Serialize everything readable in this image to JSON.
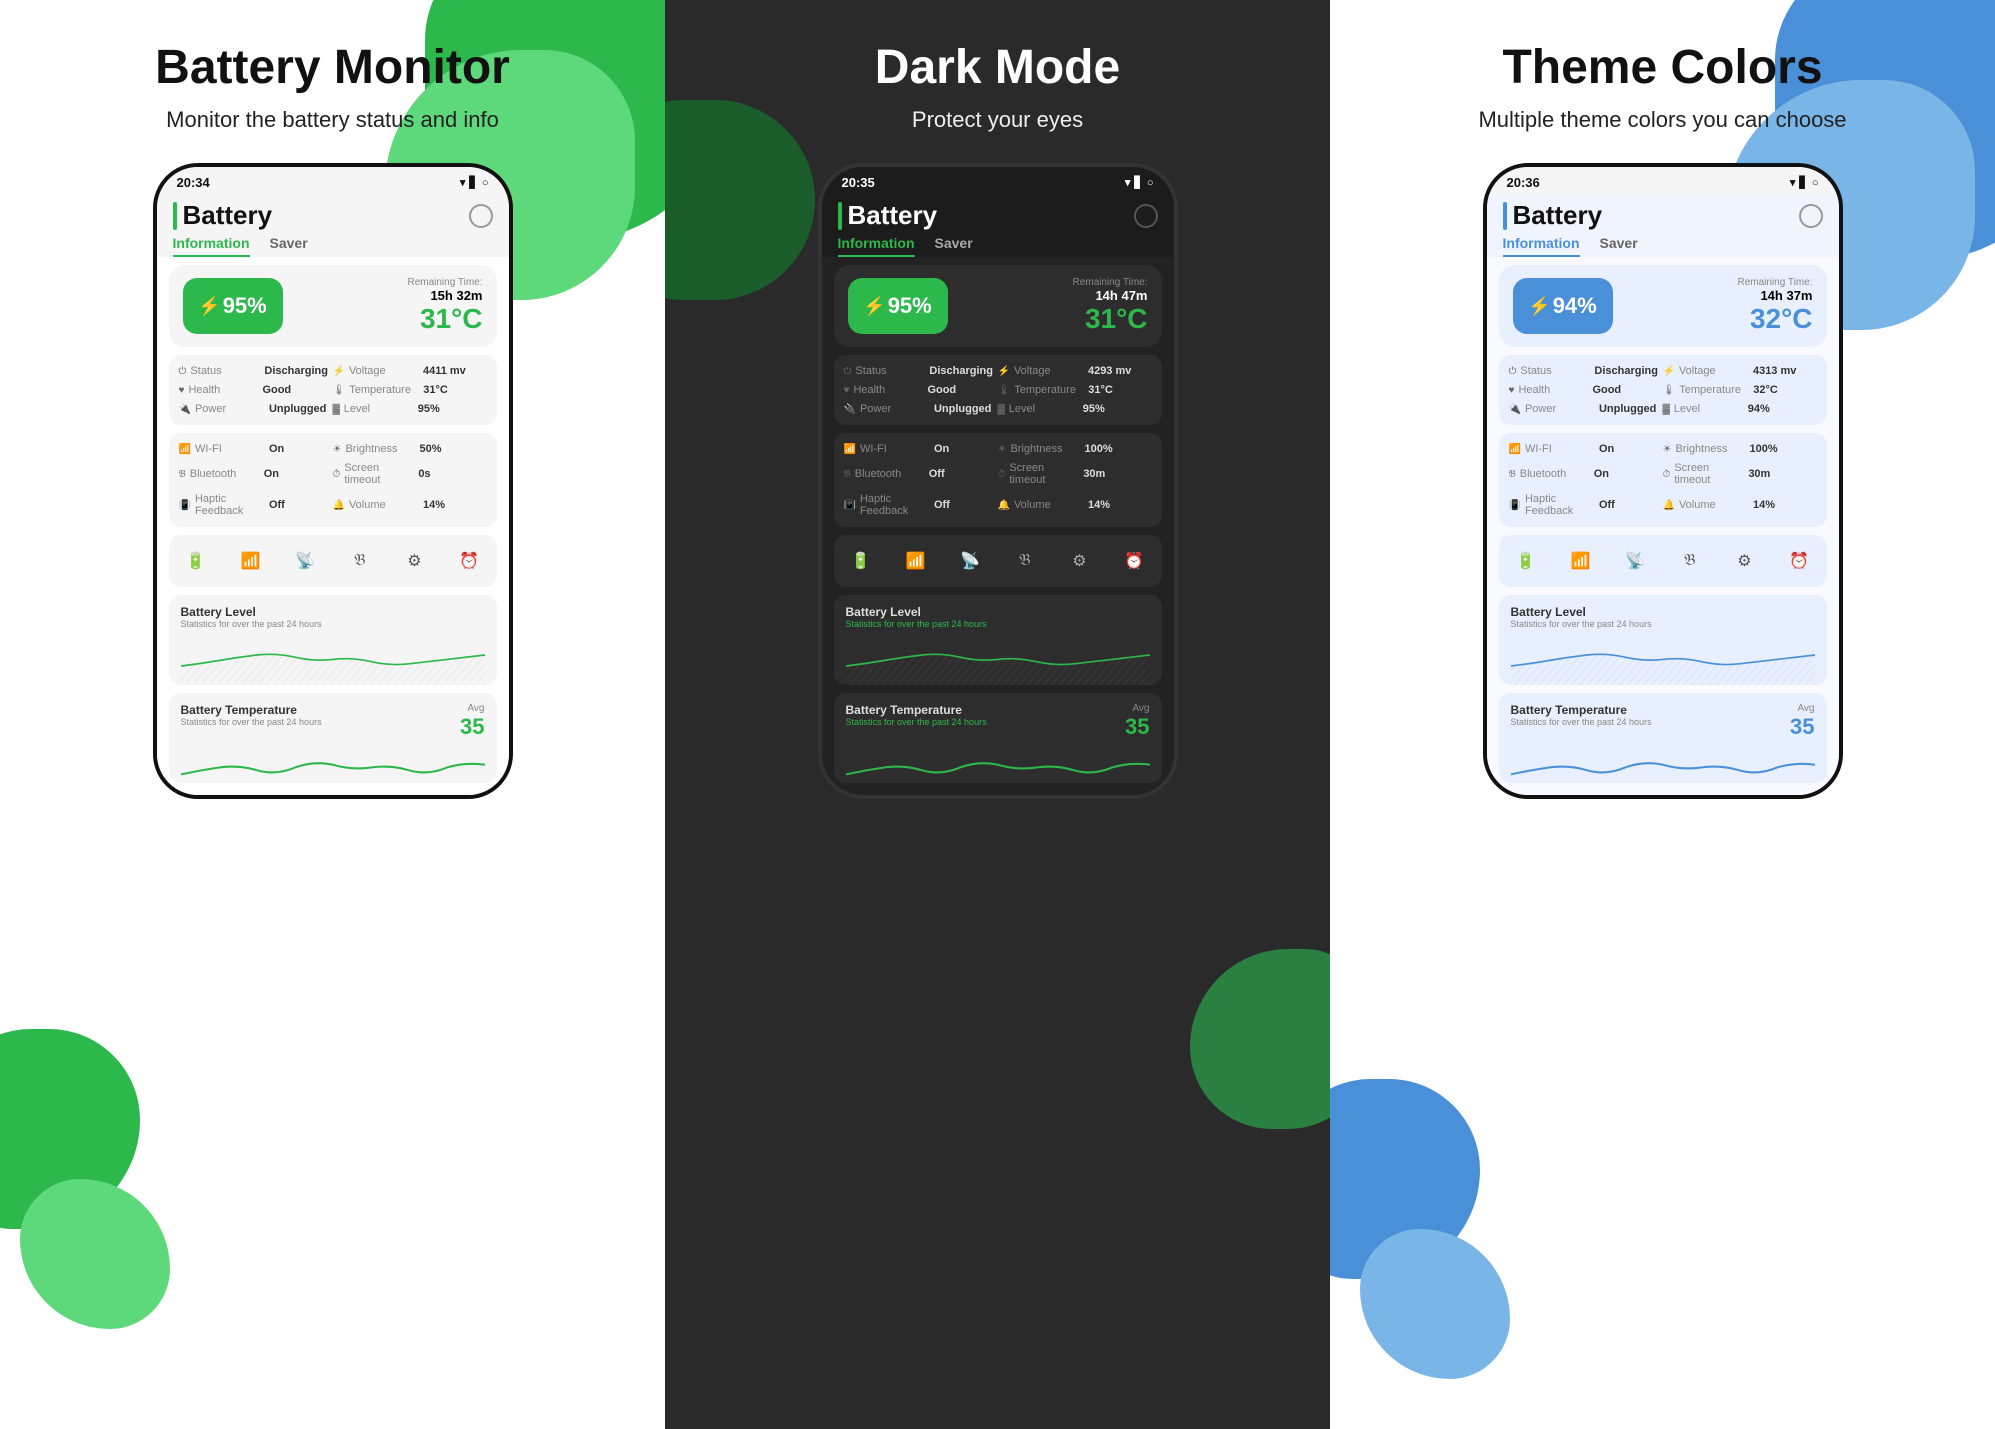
{
  "panel1": {
    "title": "Battery Monitor",
    "subtitle": "Monitor the battery status and info",
    "theme": "light",
    "phone": {
      "time": "20:34",
      "tab_info": "Information",
      "tab_saver": "Saver",
      "battery_pct": "95%",
      "remaining_label": "Remaining Time:",
      "remaining_time": "15h 32m",
      "temp": "31°C",
      "status_label": "Status",
      "status_val": "Discharging",
      "voltage_label": "Voltage",
      "voltage_val": "4411 mv",
      "health_label": "Health",
      "health_val": "Good",
      "temperature_label": "Temperature",
      "temperature_val": "31°C",
      "power_label": "Power",
      "power_val": "Unplugged",
      "level_label": "Level",
      "level_val": "95%",
      "wifi_label": "WI-FI",
      "wifi_val": "On",
      "brightness_label": "Brightness",
      "brightness_val": "50%",
      "bluetooth_label": "Bluetooth",
      "bluetooth_val": "On",
      "screen_timeout_label": "Screen timeout",
      "screen_timeout_val": "0s",
      "haptic_label": "Haptic Feedback",
      "haptic_val": "Off",
      "volume_label": "Volume",
      "volume_val": "14%",
      "chart_title": "Battery Level",
      "chart_subtitle": "Statistics for over the past 24 hours",
      "temp_title": "Battery Temperature",
      "temp_subtitle": "Statistics for over the past 24 hours",
      "avg_label": "Avg",
      "avg_val": "35"
    }
  },
  "panel2": {
    "title": "Dark Mode",
    "subtitle": "Protect your eyes",
    "theme": "dark",
    "phone": {
      "time": "20:35",
      "tab_info": "Information",
      "tab_saver": "Saver",
      "battery_pct": "95%",
      "remaining_label": "Remaining Time:",
      "remaining_time": "14h 47m",
      "temp": "31°C",
      "status_label": "Status",
      "status_val": "Discharging",
      "voltage_label": "Voltage",
      "voltage_val": "4293 mv",
      "health_label": "Health",
      "health_val": "Good",
      "temperature_label": "Temperature",
      "temperature_val": "31°C",
      "power_label": "Power",
      "power_val": "Unplugged",
      "level_label": "Level",
      "level_val": "95%",
      "wifi_label": "WI-FI",
      "wifi_val": "On",
      "brightness_label": "Brightness",
      "brightness_val": "100%",
      "bluetooth_label": "Bluetooth",
      "bluetooth_val": "Off",
      "screen_timeout_label": "Screen timeout",
      "screen_timeout_val": "30m",
      "haptic_label": "Haptic Feedback",
      "haptic_val": "Off",
      "volume_label": "Volume",
      "volume_val": "14%",
      "chart_title": "Battery Level",
      "chart_subtitle": "Statistics for over the past 24 hours",
      "temp_title": "Battery Temperature",
      "temp_subtitle": "Statistics for over the past 24 hours",
      "avg_label": "Avg",
      "avg_val": "35"
    }
  },
  "panel3": {
    "title": "Theme Colors",
    "subtitle": "Multiple theme colors you can choose",
    "theme": "blue",
    "phone": {
      "time": "20:36",
      "tab_info": "Information",
      "tab_saver": "Saver",
      "battery_pct": "94%",
      "remaining_label": "Remaining Time:",
      "remaining_time": "14h 37m",
      "temp": "32°C",
      "status_label": "Status",
      "status_val": "Discharging",
      "voltage_label": "Voltage",
      "voltage_val": "4313 mv",
      "health_label": "Health",
      "health_val": "Good",
      "temperature_label": "Temperature",
      "temperature_val": "32°C",
      "power_label": "Power",
      "power_val": "Unplugged",
      "level_label": "Level",
      "level_val": "94%",
      "wifi_label": "WI-FI",
      "wifi_val": "On",
      "brightness_label": "Brightness",
      "brightness_val": "100%",
      "bluetooth_label": "Bluetooth",
      "bluetooth_val": "On",
      "screen_timeout_label": "Screen timeout",
      "screen_timeout_val": "30m",
      "haptic_label": "Haptic Feedback",
      "haptic_val": "Off",
      "volume_label": "Volume",
      "volume_val": "14%",
      "chart_title": "Battery Level",
      "chart_subtitle": "Statistics for over the past 24 hours",
      "temp_title": "Battery Temperature",
      "temp_subtitle": "Statistics for over the past 24 hours",
      "avg_label": "Avg",
      "avg_val": "35"
    }
  }
}
